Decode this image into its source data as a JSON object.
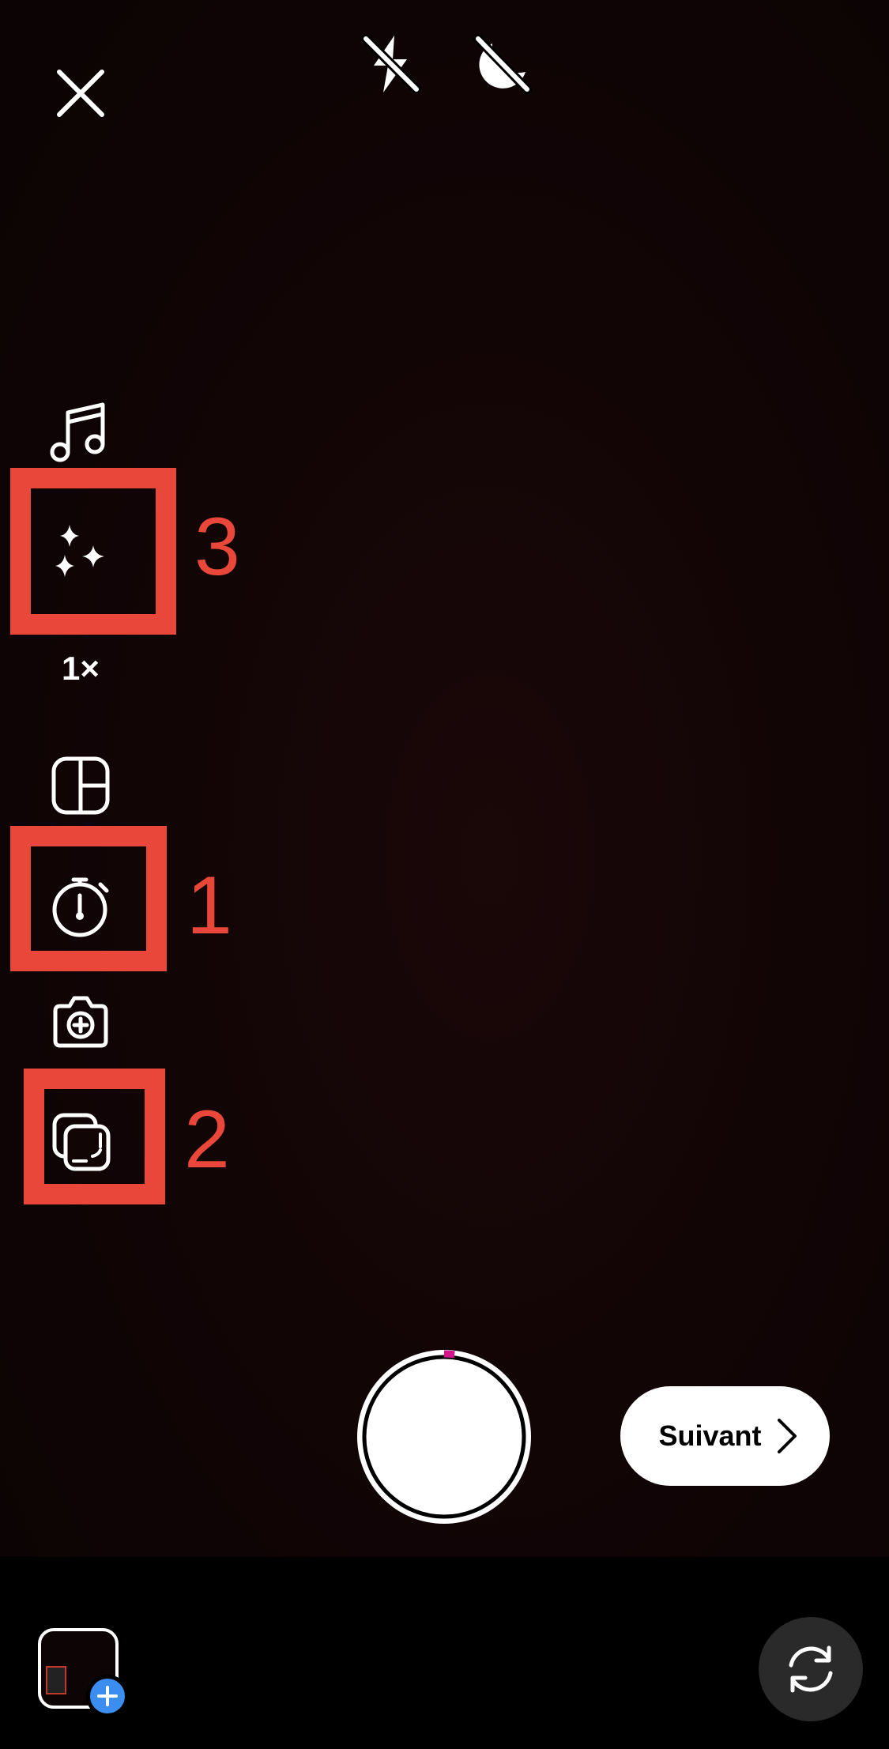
{
  "camera": {
    "zoom_level": "1×",
    "recording_progress": 0.02
  },
  "top_controls": [
    {
      "name": "close",
      "icon": "close-icon"
    },
    {
      "name": "flash-off",
      "icon": "flash-off-icon"
    },
    {
      "name": "night-mode-off",
      "icon": "night-mode-off-icon"
    }
  ],
  "side_tools": [
    {
      "name": "music",
      "icon": "music-note-icon"
    },
    {
      "name": "effects",
      "icon": "sparkles-icon"
    },
    {
      "name": "zoom",
      "label": "1×"
    },
    {
      "name": "layout",
      "icon": "layout-grid-icon"
    },
    {
      "name": "timer",
      "icon": "timer-icon"
    },
    {
      "name": "add-photo",
      "icon": "camera-plus-icon"
    },
    {
      "name": "multi-capture",
      "icon": "stacked-frames-icon"
    }
  ],
  "annotations": [
    {
      "number": "3",
      "target": "effects"
    },
    {
      "number": "1",
      "target": "timer"
    },
    {
      "number": "2",
      "target": "multi-capture"
    }
  ],
  "next_button": {
    "label": "Suivant",
    "icon": "chevron-right-icon"
  },
  "bottom_bar": {
    "gallery_icon": "gallery-thumbnail-icon",
    "gallery_add_icon": "plus-icon",
    "flip_icon": "flip-camera-icon"
  },
  "colors": {
    "annotation_red": "#e8473a",
    "progress_magenta": "#d4148a",
    "gallery_blue": "#3b8df0",
    "viewfinder": "#120506"
  }
}
